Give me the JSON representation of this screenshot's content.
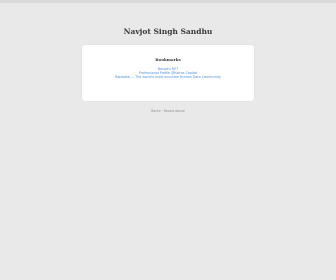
{
  "header": {
    "site_title": "Navjot Singh Sandhu"
  },
  "bookmarks": {
    "heading": "Bookmarks",
    "links": [
      {
        "label": "Navjot's NFT"
      },
      {
        "label": "Professional Profile @Kairos Capital"
      },
      {
        "label": "Rapidata — The world's most accurate Human Data Community"
      }
    ]
  },
  "footer": {
    "brand": "Bento",
    "separator": "·",
    "link_label": "Report abuse"
  }
}
